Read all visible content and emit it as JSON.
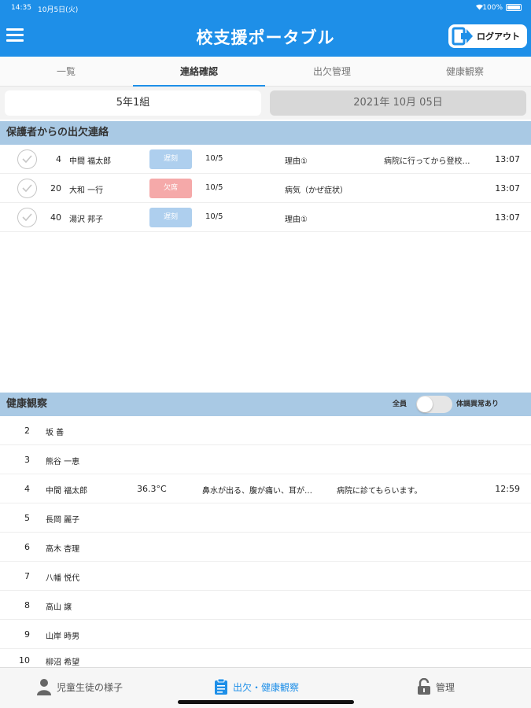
{
  "statusbar": {
    "time": "14:35",
    "date": "10月5日(火)",
    "battery": "100%"
  },
  "header": {
    "title": "校支援ポータブル",
    "logout_label": "ログアウト"
  },
  "tabs": [
    {
      "label": "一覧"
    },
    {
      "label": "連絡確認"
    },
    {
      "label": "出欠管理"
    },
    {
      "label": "健康観察"
    }
  ],
  "selectors": {
    "class_label": "5年1組",
    "date_label": "2021年 10月 05日"
  },
  "attendance": {
    "title": "保護者からの出欠連絡",
    "rows": [
      {
        "num": "4",
        "name": "中間 福太郎",
        "status": "遅刻",
        "status_color": "#aecfee",
        "date": "10/5",
        "reason": "理由①",
        "memo": "病院に行ってから登校…",
        "time": "13:07"
      },
      {
        "num": "20",
        "name": "大和 一行",
        "status": "欠席",
        "status_color": "#f5a9a9",
        "date": "10/5",
        "reason": "病気（かぜ症状）",
        "memo": "",
        "time": "13:07"
      },
      {
        "num": "40",
        "name": "湯沢 邦子",
        "status": "遅刻",
        "status_color": "#aecfee",
        "date": "10/5",
        "reason": "理由①",
        "memo": "",
        "time": "13:07"
      }
    ]
  },
  "health": {
    "title": "健康観察",
    "toggle_left": "全員",
    "toggle_right": "体調異常あり",
    "rows": [
      {
        "num": "2",
        "name": "坂 善",
        "temp": "",
        "symptom": "",
        "note": "",
        "time": ""
      },
      {
        "num": "3",
        "name": "熊谷 一恵",
        "temp": "",
        "symptom": "",
        "note": "",
        "time": ""
      },
      {
        "num": "4",
        "name": "中間 福太郎",
        "temp": "36.3°C",
        "symptom": "鼻水が出る、腹が痛い、耳が…",
        "note": "病院に診てもらいます。",
        "time": "12:59"
      },
      {
        "num": "5",
        "name": "長岡 麗子",
        "temp": "",
        "symptom": "",
        "note": "",
        "time": ""
      },
      {
        "num": "6",
        "name": "高木 杏理",
        "temp": "",
        "symptom": "",
        "note": "",
        "time": ""
      },
      {
        "num": "7",
        "name": "八幡 悦代",
        "temp": "",
        "symptom": "",
        "note": "",
        "time": ""
      },
      {
        "num": "8",
        "name": "高山 譲",
        "temp": "",
        "symptom": "",
        "note": "",
        "time": ""
      },
      {
        "num": "9",
        "name": "山岸 時男",
        "temp": "",
        "symptom": "",
        "note": "",
        "time": ""
      },
      {
        "num": "10",
        "name": "柳沼 希望",
        "temp": "",
        "symptom": "",
        "note": "",
        "time": ""
      }
    ]
  },
  "bottombar": {
    "items": [
      {
        "label": "児童生徒の様子",
        "icon": "person-icon"
      },
      {
        "label": "出欠・健康観察",
        "icon": "clipboard-icon"
      },
      {
        "label": "管理",
        "icon": "lock-icon"
      }
    ]
  },
  "colors": {
    "accent": "#1e8fe8",
    "section_bg": "#a9c9e4",
    "late": "#aecfee",
    "absent": "#f5a9a9"
  }
}
